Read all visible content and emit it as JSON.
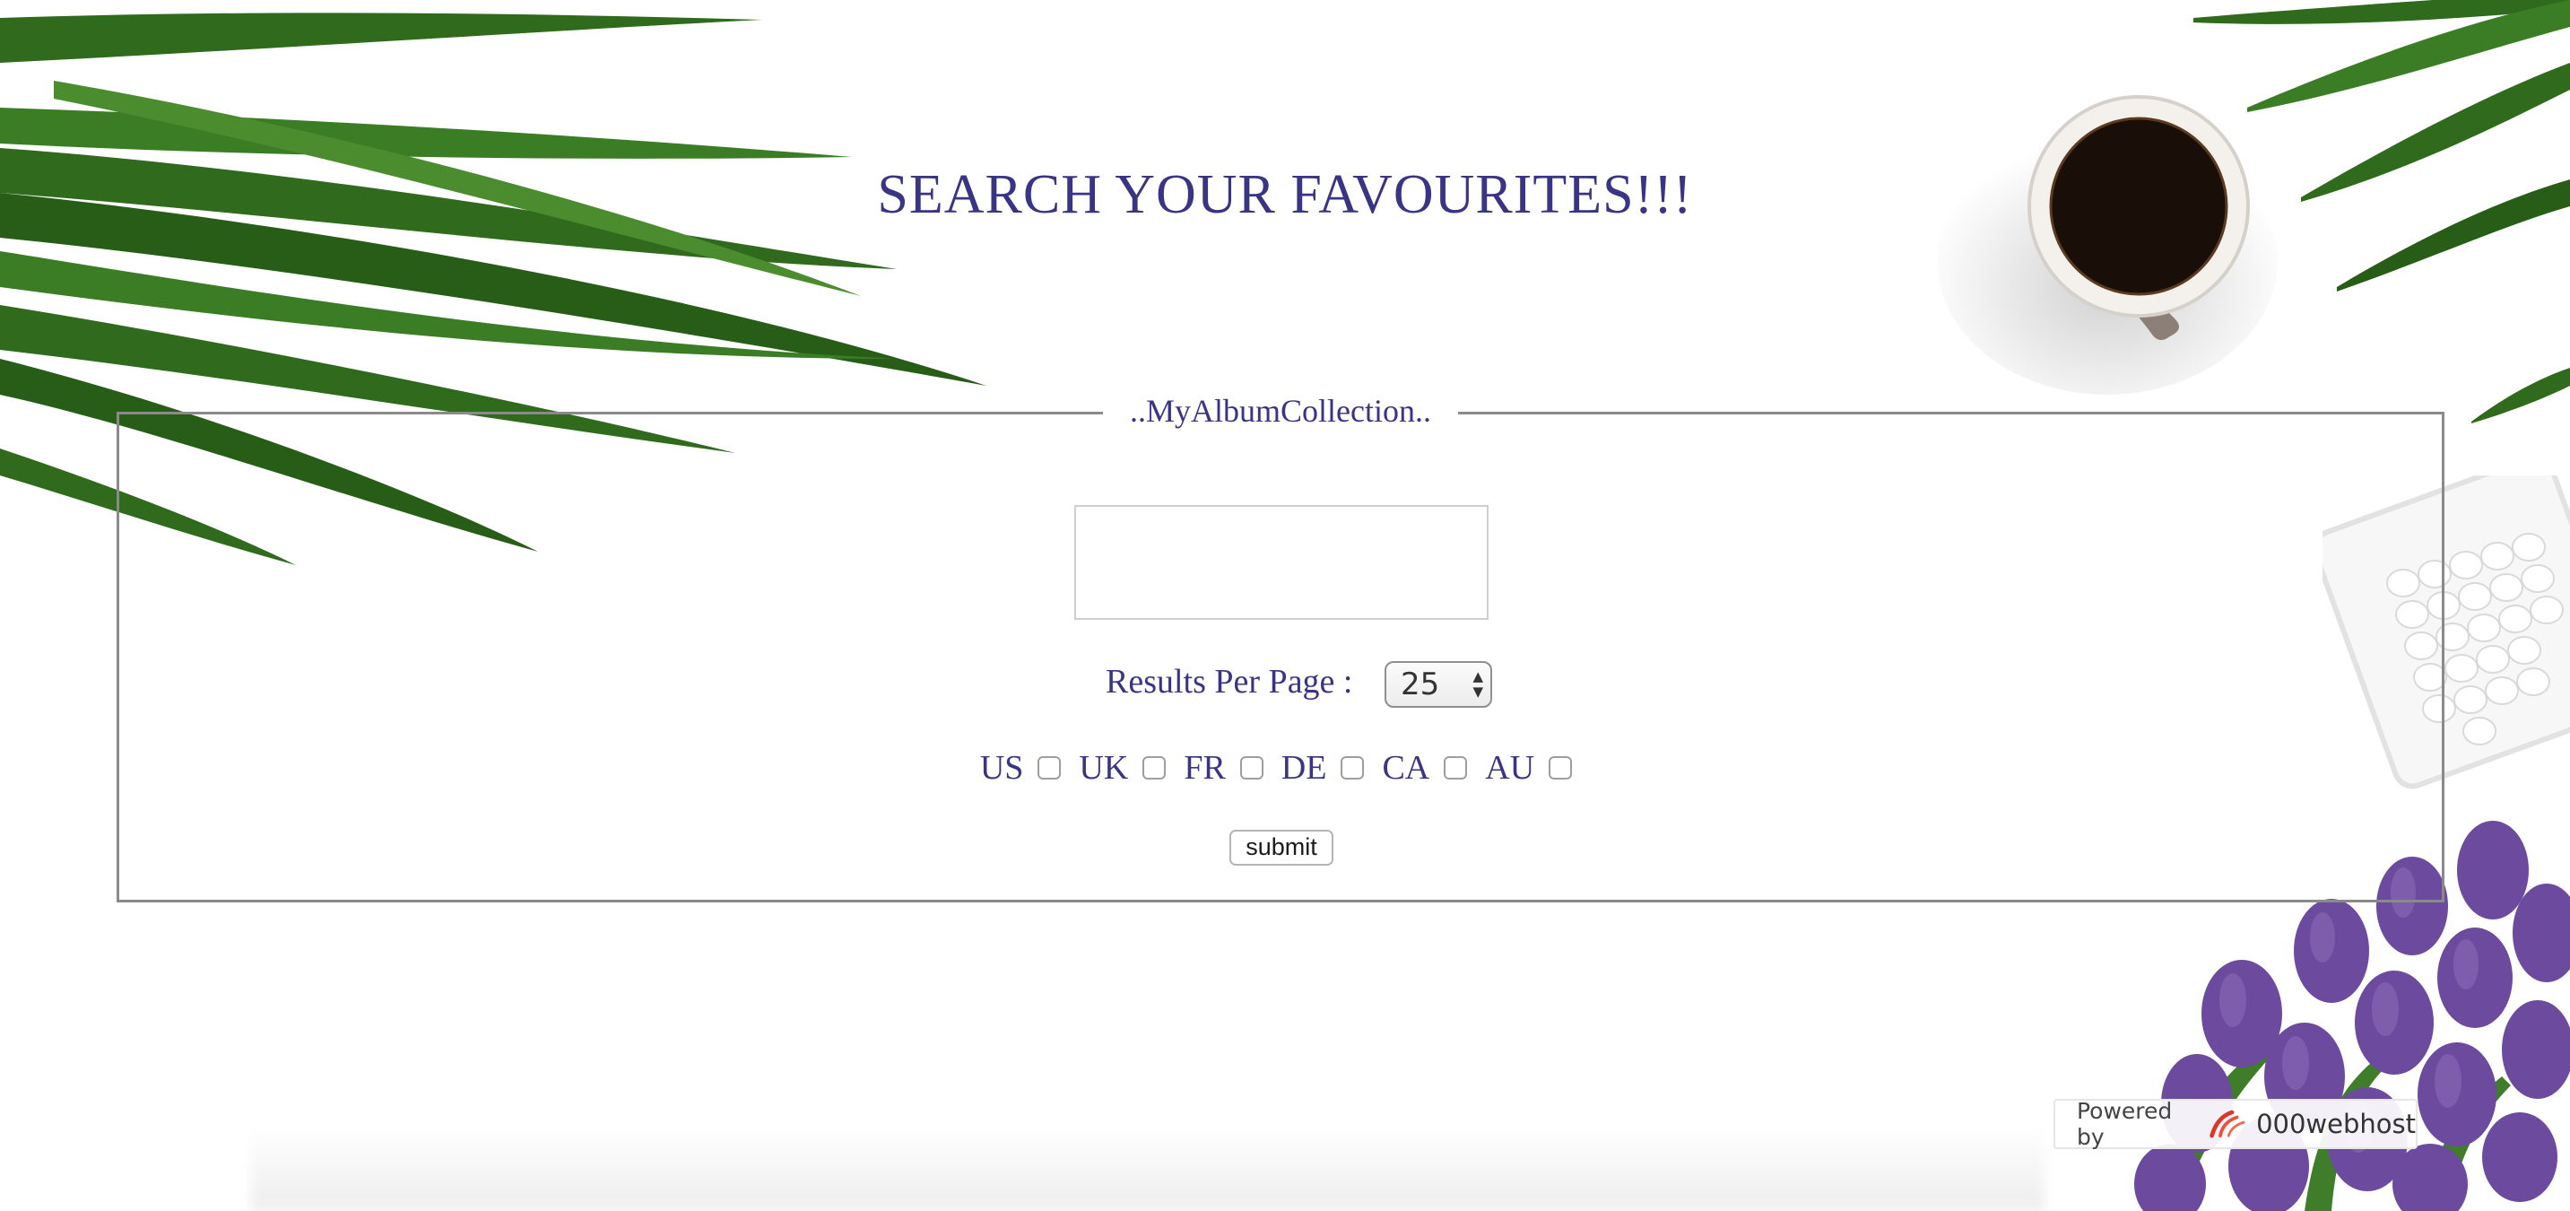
{
  "page": {
    "title": "SEARCH YOUR FAVOURITES!!!"
  },
  "form": {
    "legend": "..MyAlbumCollection..",
    "search": {
      "value": "",
      "placeholder": ""
    },
    "results_per_page": {
      "label": "Results Per Page :",
      "selected": "25"
    },
    "countries": [
      {
        "code": "US",
        "checked": false
      },
      {
        "code": "UK",
        "checked": false
      },
      {
        "code": "FR",
        "checked": false
      },
      {
        "code": "DE",
        "checked": false
      },
      {
        "code": "CA",
        "checked": false
      },
      {
        "code": "AU",
        "checked": false
      }
    ],
    "submit_label": "submit"
  },
  "footer": {
    "powered_by": "Powered by",
    "host": "000webhost",
    "logo_icon": "000webhost-logo-icon"
  },
  "colors": {
    "text": "#3a3485",
    "border": "#8a8a8a",
    "leaf": "#2f6a1d",
    "tulip": "#6c4a9e"
  },
  "decorations": [
    "palm-leaves-image",
    "coffee-cup-image",
    "candy-bowl-image",
    "purple-tulips-image"
  ]
}
